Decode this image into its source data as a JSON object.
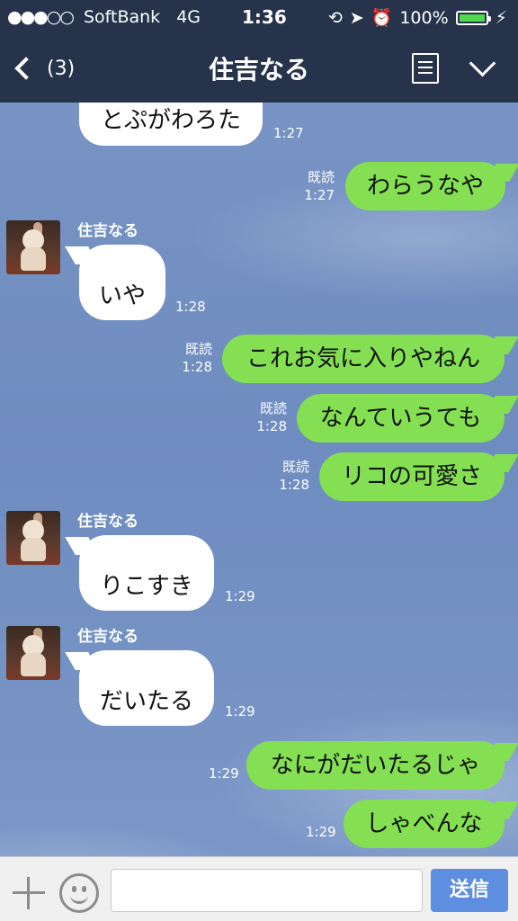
{
  "status": {
    "carrier": "SoftBank",
    "network": "4G",
    "time": "1:36",
    "battery": "100%"
  },
  "header": {
    "back_count": "(3)",
    "title": "住吉なる"
  },
  "contact_name": "住吉なる",
  "messages": [
    {
      "dir": "in",
      "text": "とぷがわろた",
      "time": "1:27"
    },
    {
      "dir": "out",
      "text": "わらうなや",
      "read": "既読",
      "time": "1:27"
    },
    {
      "dir": "in",
      "text": "いや",
      "time": "1:28",
      "sender": "住吉なる"
    },
    {
      "dir": "out",
      "text": "これお気に入りやねん",
      "read": "既読",
      "time": "1:28"
    },
    {
      "dir": "out",
      "text": "なんていうても",
      "read": "既読",
      "time": "1:28"
    },
    {
      "dir": "out",
      "text": "リコの可愛さ",
      "read": "既読",
      "time": "1:28"
    },
    {
      "dir": "in",
      "text": "りこすき",
      "time": "1:29",
      "sender": "住吉なる"
    },
    {
      "dir": "in",
      "text": "だいたる",
      "time": "1:29",
      "sender": "住吉なる"
    },
    {
      "dir": "out",
      "text": "なにがだいたるじゃ",
      "time": "1:29"
    },
    {
      "dir": "out",
      "text": "しゃべんな",
      "time": "1:29"
    }
  ],
  "input": {
    "placeholder": "",
    "send_label": "送信"
  },
  "colors": {
    "header_bg": "#26334a",
    "out_bubble": "#84e052",
    "in_bubble": "#ffffff",
    "send_button": "#5d8ee0",
    "battery": "#51d94c"
  }
}
